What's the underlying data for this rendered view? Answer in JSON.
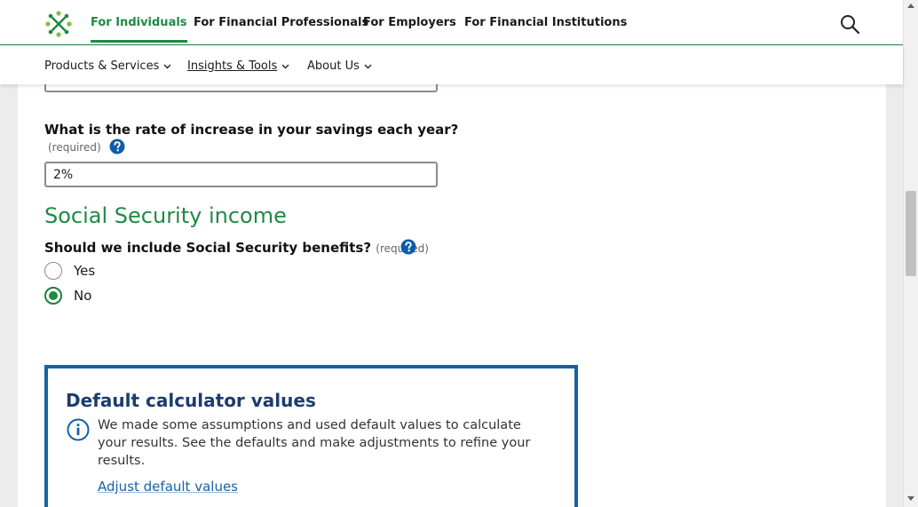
{
  "top_nav": {
    "tabs": [
      {
        "label": "For Individuals",
        "active": true
      },
      {
        "label": "For Financial Professionals",
        "active": false
      },
      {
        "label": "For Employers",
        "active": false
      },
      {
        "label": "For Financial Institutions",
        "active": false
      }
    ],
    "logo_icon": "principal-logo-icon",
    "search_icon": "search-icon"
  },
  "sub_nav": {
    "items": [
      {
        "label": "Products & Services",
        "icon": "chevron-down-icon"
      },
      {
        "label": "Insights & Tools",
        "icon": "chevron-down-icon"
      },
      {
        "label": "About Us",
        "icon": "chevron-down-icon"
      }
    ]
  },
  "form": {
    "partial_input_value": "",
    "savings_increase": {
      "label": "What is the rate of increase in your savings each year?",
      "required_text": "(required)",
      "value": "2%",
      "help_icon": "question-circle-icon"
    },
    "social_security": {
      "section_title": "Social Security income",
      "question": "Should we include Social Security benefits?",
      "required_text": "(required)",
      "help_icon": "question-circle-icon",
      "options": [
        {
          "label": "Yes",
          "checked": false
        },
        {
          "label": "No",
          "checked": true
        }
      ]
    }
  },
  "defaults_box": {
    "title": "Default calculator values",
    "text": "We made some assumptions and used default values to calculate your results. See the defaults and make adjustments to refine your results.",
    "link": "Adjust default values",
    "icon": "info-circle-icon"
  },
  "colors": {
    "brand_green": "#1f8a44",
    "link_blue": "#1562a8",
    "title_navy": "#1d3c6e",
    "help_blue": "#0f5da8"
  }
}
